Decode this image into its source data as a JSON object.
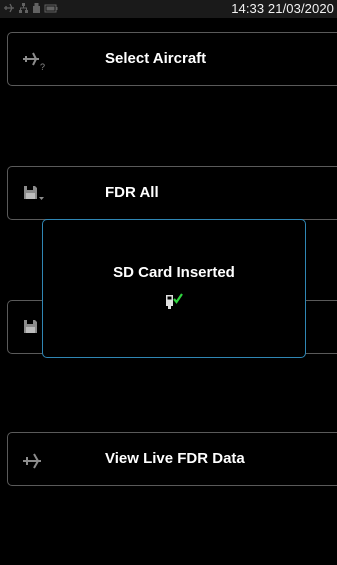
{
  "status_bar": {
    "time": "14:33 21/03/2020",
    "icons": [
      "aircraft-icon",
      "network-icon",
      "usb-icon",
      "battery-icon"
    ]
  },
  "menu": {
    "items": [
      {
        "label": "Select Aircraft",
        "icon": "aircraft-question-icon"
      },
      {
        "label": "FDR All",
        "icon": "floppy-disk-dropdown-icon"
      },
      {
        "label": "",
        "icon": "floppy-disk-icon"
      },
      {
        "label": "View Live FDR Data",
        "icon": "aircraft-icon"
      }
    ]
  },
  "dialog": {
    "title": "SD Card Inserted",
    "icon": "sd-card-check-icon"
  },
  "colors": {
    "background": "#000000",
    "button_border": "#5a5a5a",
    "dialog_border": "#2f86b4",
    "check": "#2fd33f"
  }
}
